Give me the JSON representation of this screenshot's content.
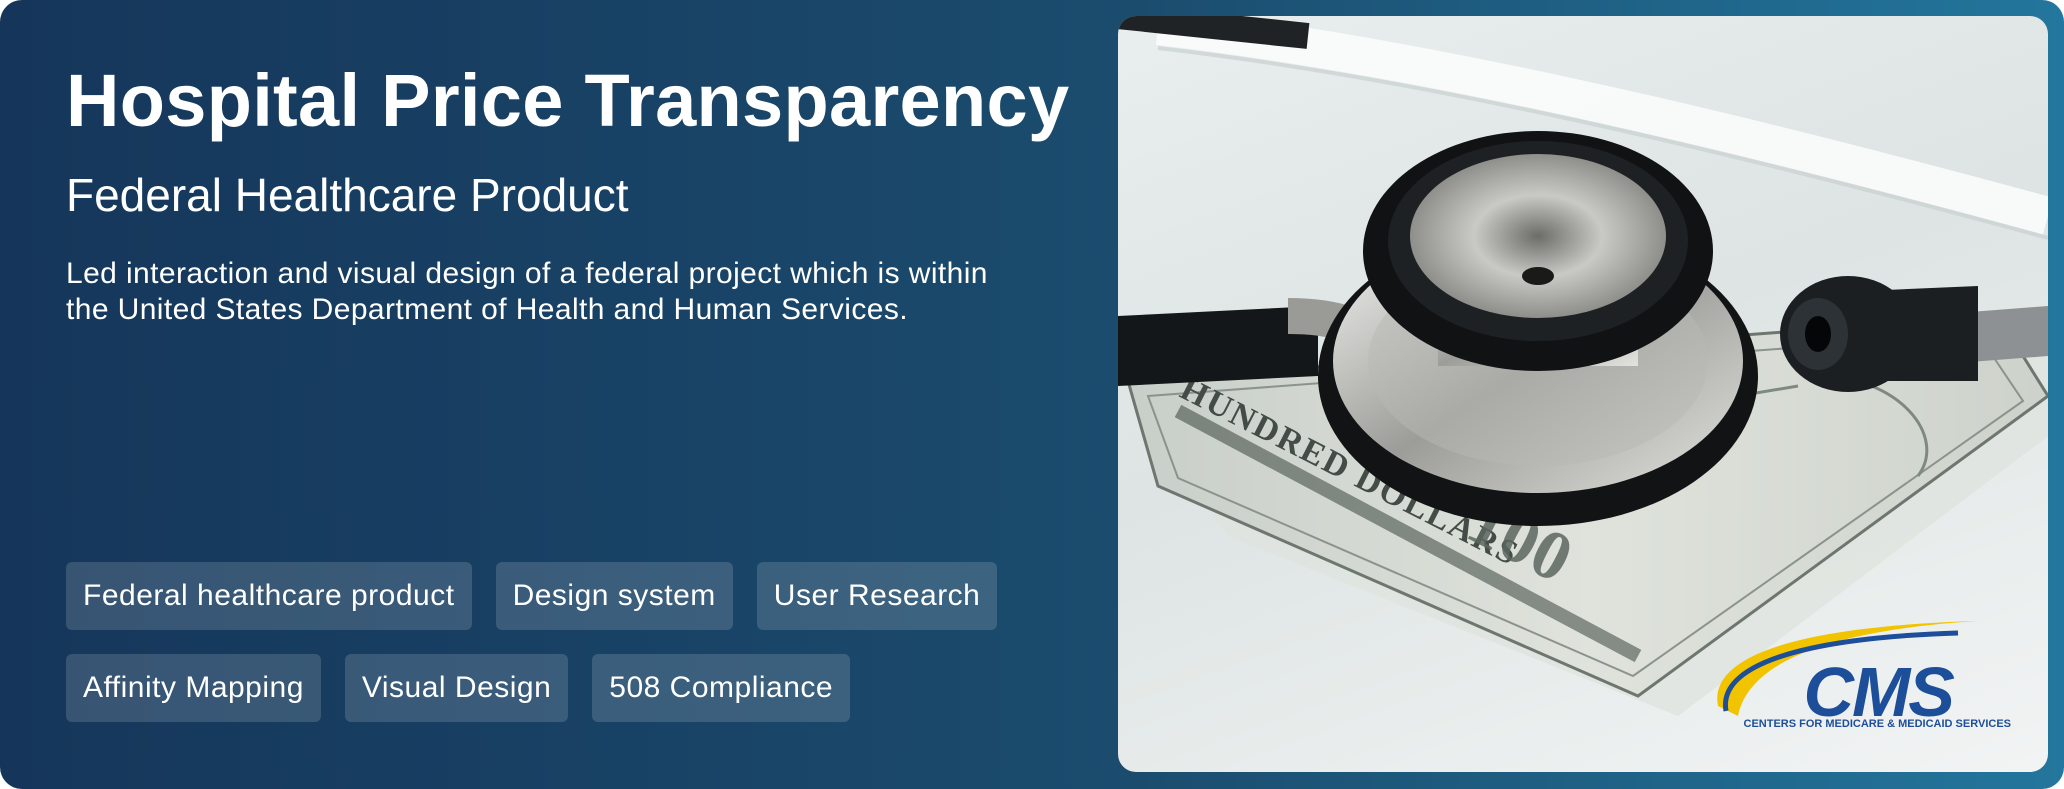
{
  "header": {
    "title": "Hospital Price Transparency",
    "subtitle": "Federal Healthcare Product"
  },
  "description": "Led interaction and visual design of a federal project which is within the United States Department of Health and Human Services.",
  "tags": [
    [
      "Federal healthcare product",
      "Design system",
      "User Research"
    ],
    [
      "Affinity Mapping",
      "Visual Design",
      "508 Compliance"
    ]
  ],
  "image": {
    "subject": "stethoscope-on-hundred-dollar-bills",
    "bill_text": "HUNDRED DOLLARS",
    "bill_number": "100",
    "logo": {
      "text": "CMS",
      "tagline": "CENTERS FOR MEDICARE & MEDICAID SERVICES",
      "color": "#1d4e9a",
      "swoosh_color": "#f2c400"
    }
  },
  "colors": {
    "gradient_start": "#15365a",
    "gradient_end": "#23769d",
    "tag_background": "rgba(255,255,255,0.15)",
    "text": "#ffffff"
  }
}
